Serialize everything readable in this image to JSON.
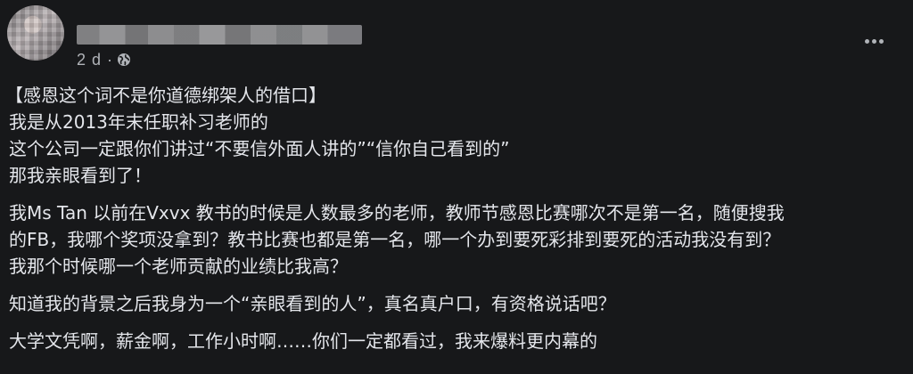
{
  "post": {
    "time": "2 d ·",
    "paragraphs": [
      [
        "【感恩这个词不是你道德绑架人的借口】",
        "我是从2013年末任职补习老师的",
        "这个公司一定跟你们讲过“不要信外面人讲的”“信你自己看到的”",
        "那我亲眼看到了！"
      ],
      [
        "我Ms Tan 以前在Vxvx 教书的时候是人数最多的老师，教师节感恩比赛哪次不是第一名，随便搜我",
        "的FB，我哪个奖项没拿到？教书比赛也都是第一名，哪一个办到要死彩排到要死的活动我没有到？",
        "我那个时候哪一个老师贡献的业绩比我高？"
      ],
      [
        "知道我的背景之后我身为一个“亲眼看到的人”，真名真户口，有资格说话吧？"
      ],
      [
        "大学文凭啊，薪金啊，工作小时啊……你们一定都看过，我来爆料更内幕的"
      ]
    ]
  },
  "icons": {
    "audience": "globe-icon",
    "menu": "more-horizontal-icon"
  }
}
